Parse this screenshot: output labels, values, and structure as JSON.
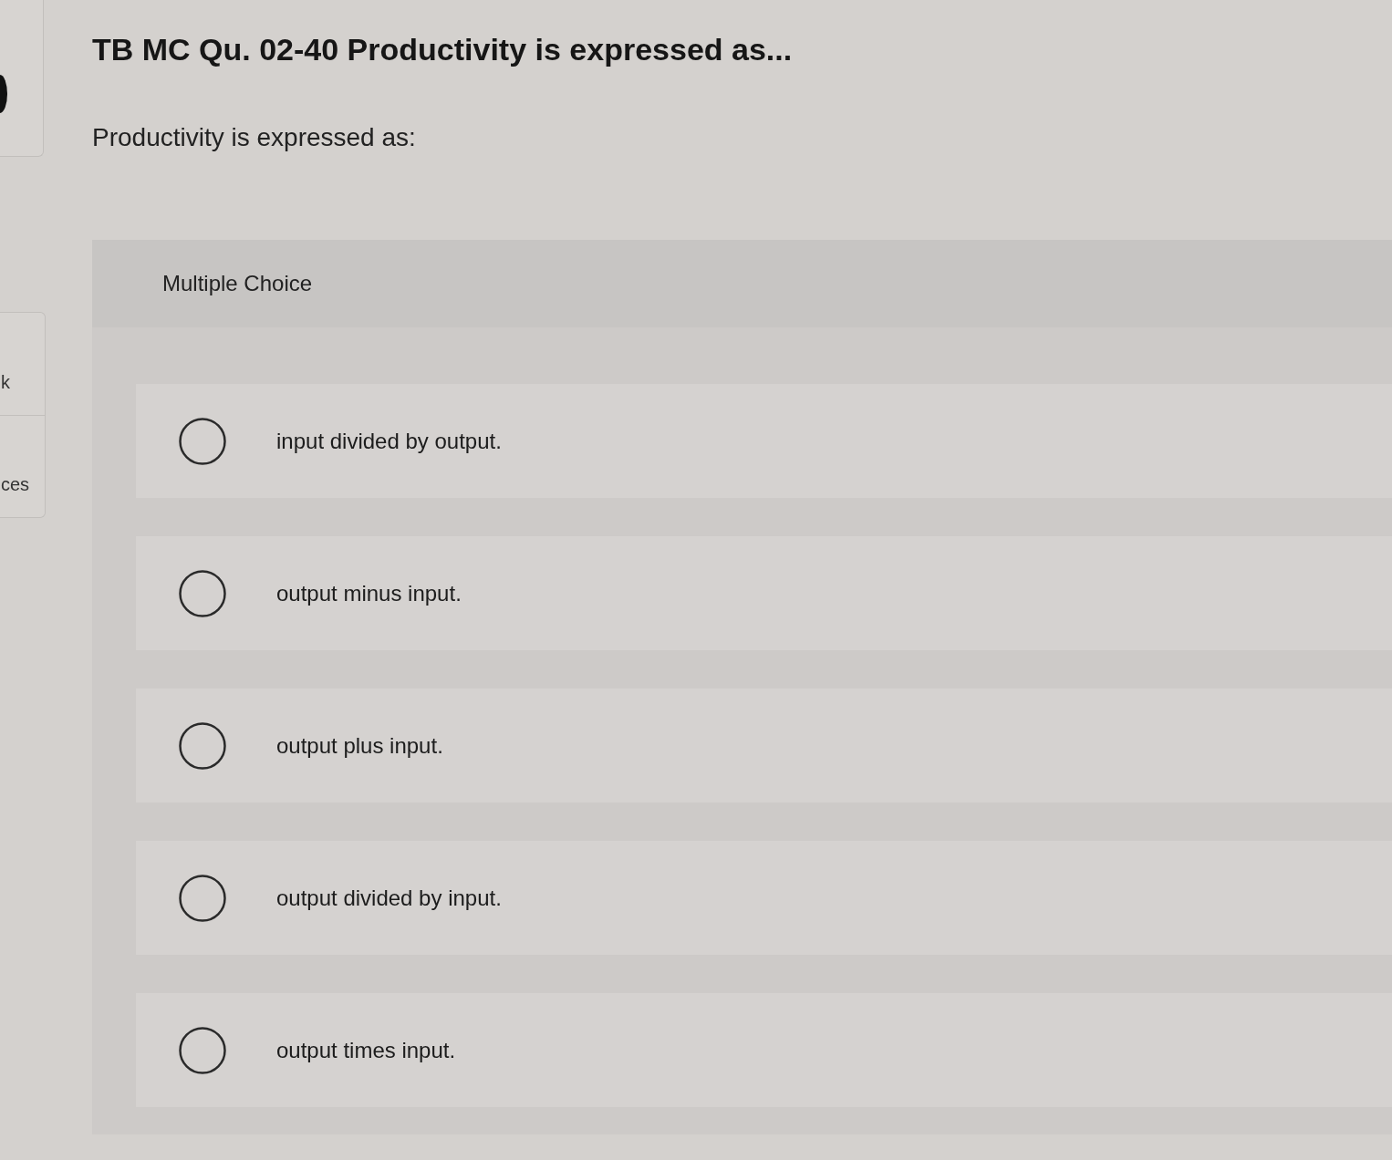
{
  "side_panel": {
    "buttons": [
      {
        "label": "k"
      },
      {
        "label": "ces"
      }
    ]
  },
  "question": {
    "title": "TB MC Qu. 02-40 Productivity is expressed as...",
    "prompt": "Productivity is expressed as:"
  },
  "answer_panel": {
    "heading": "Multiple Choice",
    "options": [
      {
        "label": "input divided by output.",
        "selected": false
      },
      {
        "label": "output minus input.",
        "selected": false
      },
      {
        "label": "output plus input.",
        "selected": false
      },
      {
        "label": "output divided by input.",
        "selected": false
      },
      {
        "label": "output times input.",
        "selected": false
      }
    ]
  }
}
